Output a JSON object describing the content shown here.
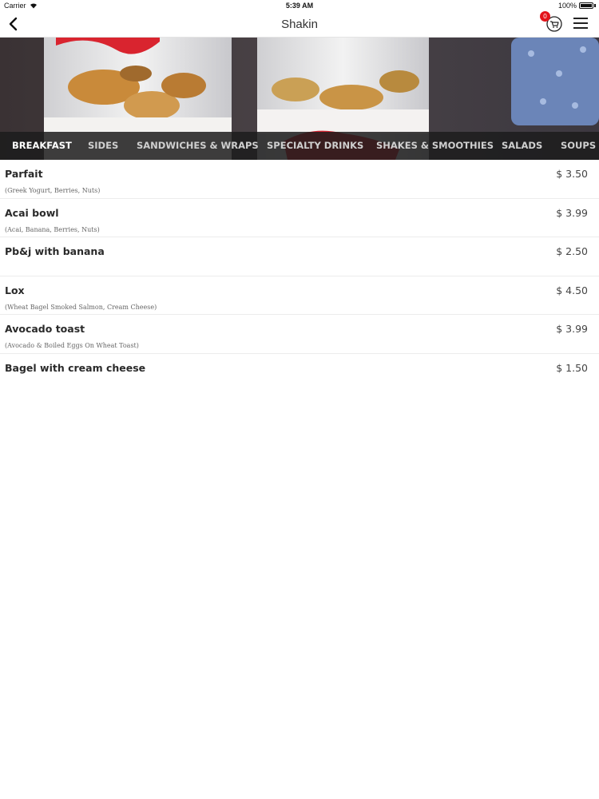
{
  "status": {
    "carrier": "Carrier",
    "time": "5:39 AM",
    "battery": "100%"
  },
  "nav": {
    "title": "Shakin",
    "cart_count": "0",
    "back_icon": "chevron-left-icon",
    "cart_icon": "cart-icon",
    "menu_icon": "hamburger-menu-icon"
  },
  "categories": [
    {
      "label": "BREAKFAST",
      "active": true
    },
    {
      "label": "SIDES",
      "active": false
    },
    {
      "label": "SANDWICHES & WRAPS",
      "active": false
    },
    {
      "label": "SPECIALTY DRINKS",
      "active": false
    },
    {
      "label": "SHAKES & SMOOTHIES",
      "active": false
    },
    {
      "label": "SALADS",
      "active": false
    },
    {
      "label": "SOUPS",
      "active": false
    }
  ],
  "items": [
    {
      "name": "Parfait",
      "description": "(Greek Yogurt, Berries, Nuts)",
      "price": "$ 3.50"
    },
    {
      "name": "Acai bowl",
      "description": "(Acai, Banana, Berries, Nuts)",
      "price": "$ 3.99"
    },
    {
      "name": "Pb&j with banana",
      "description": "",
      "price": "$ 2.50"
    },
    {
      "name": "Lox",
      "description": "(Wheat Bagel Smoked Salmon, Cream Cheese)",
      "price": "$ 4.50"
    },
    {
      "name": "Avocado toast",
      "description": "(Avocado & Boiled Eggs On Wheat Toast)",
      "price": "$ 3.99"
    },
    {
      "name": "Bagel with cream cheese",
      "description": "",
      "price": "$ 1.50"
    }
  ],
  "colors": {
    "badge": "#e3141b",
    "category_bar": "#1c1c1c",
    "active_tab": "#ffffff"
  }
}
